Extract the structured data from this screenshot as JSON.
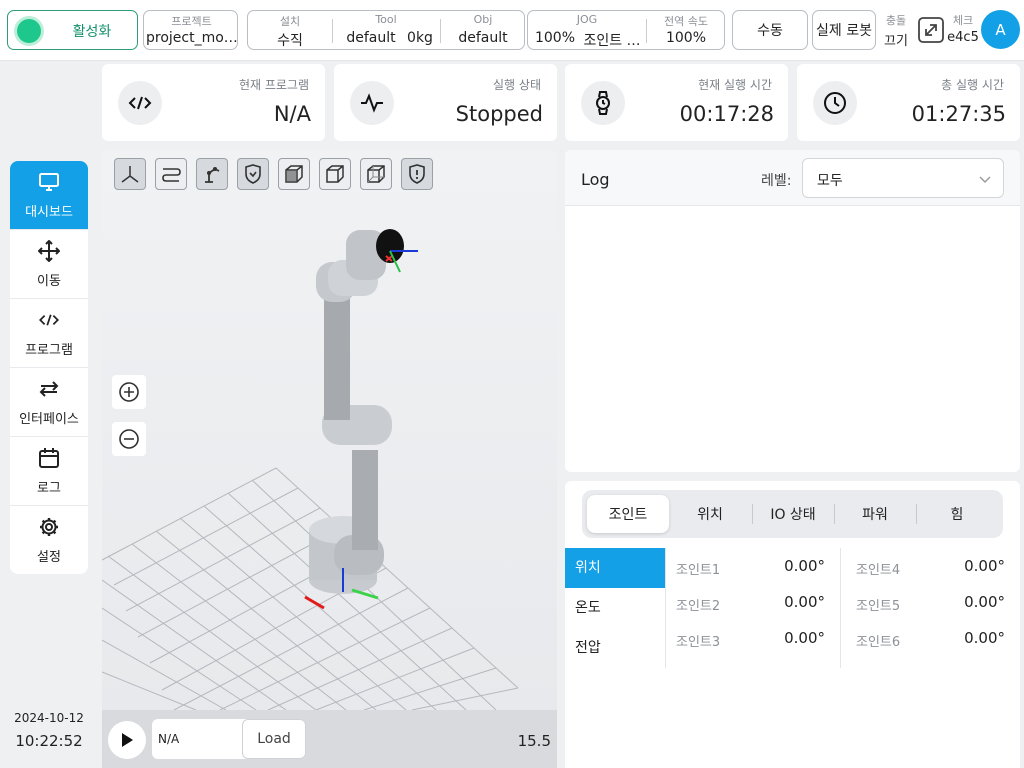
{
  "topbar": {
    "activate_label": "활성화",
    "project_label": "프로젝트",
    "project_value": "project_mo…",
    "install_label": "설치",
    "install_value": "수직",
    "tool_label": "Tool",
    "tool_value": "default",
    "tool_weight": "0kg",
    "obj_label": "Obj",
    "obj_value": "default",
    "jog_label": "JOG",
    "jog_percent": "100%",
    "jog_value": "조인트 …",
    "speed_label": "전역 속도",
    "speed_value": "100%",
    "manual_label": "수동",
    "real_robot_label": "실제 로봇",
    "collision_label": "충돌",
    "collision_value": "끄기",
    "check_label": "체크",
    "check_value": "e4c5",
    "avatar_letter": "A"
  },
  "cards": {
    "program": {
      "label": "현재 프로그램",
      "value": "N/A",
      "icon": "code-icon"
    },
    "state": {
      "label": "실행 상태",
      "value": "Stopped",
      "icon": "pulse-icon"
    },
    "current_time": {
      "label": "현재 실행 시간",
      "value": "00:17:28",
      "icon": "watch-icon"
    },
    "total_time": {
      "label": "총 실행 시간",
      "value": "01:27:35",
      "icon": "clock-icon"
    }
  },
  "sidebar": {
    "items": [
      {
        "label": "대시보드",
        "icon": "monitor-icon"
      },
      {
        "label": "이동",
        "icon": "move-icon"
      },
      {
        "label": "프로그램",
        "icon": "code-icon"
      },
      {
        "label": "인터페이스",
        "icon": "swap-icon"
      },
      {
        "label": "로그",
        "icon": "calendar-icon"
      },
      {
        "label": "설정",
        "icon": "gear-icon"
      }
    ],
    "date": "2024-10-12",
    "time": "10:22:52"
  },
  "viewer": {
    "program_value": "N/A",
    "load_label": "Load",
    "fps": "15.5"
  },
  "log": {
    "title": "Log",
    "level_label": "레벨:",
    "level_value": "모두"
  },
  "joint_panel": {
    "tabs": [
      "조인트",
      "위치",
      "IO 상태",
      "파워",
      "힘"
    ],
    "sub_tabs": [
      "위치",
      "온도",
      "전압"
    ],
    "joints": [
      {
        "name": "조인트1",
        "value": "0.00°"
      },
      {
        "name": "조인트2",
        "value": "0.00°"
      },
      {
        "name": "조인트3",
        "value": "0.00°"
      },
      {
        "name": "조인트4",
        "value": "0.00°"
      },
      {
        "name": "조인트5",
        "value": "0.00°"
      },
      {
        "name": "조인트6",
        "value": "0.00°"
      }
    ]
  },
  "colors": {
    "accent": "#13a0e6",
    "active_green": "#1ec88c"
  }
}
